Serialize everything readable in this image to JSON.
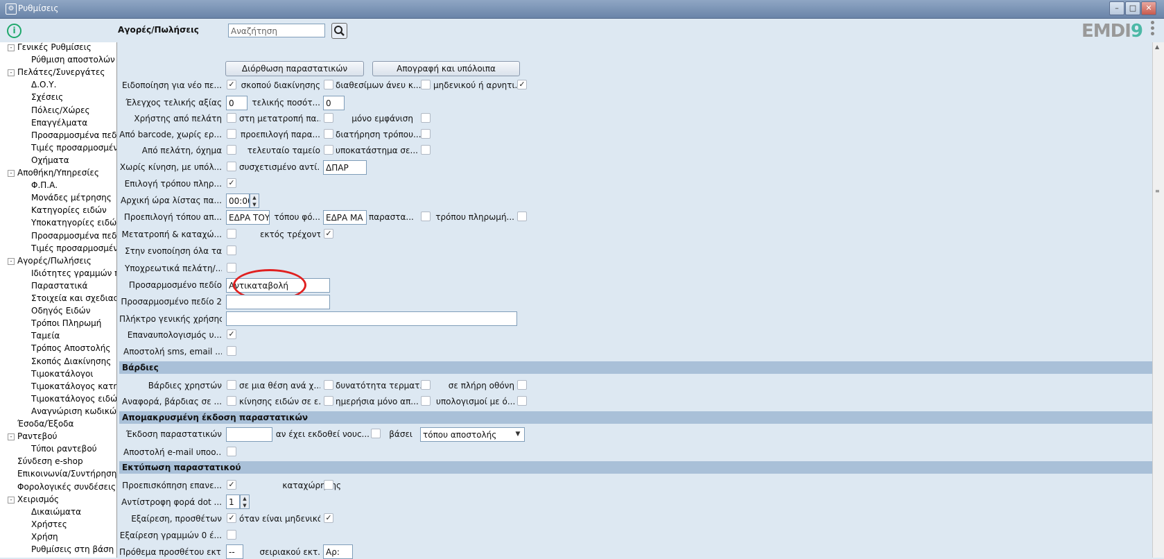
{
  "window": {
    "title": "Ρυθμίσεις"
  },
  "topbar": {
    "title": "Αγορές/Πωλήσεις",
    "search_placeholder": "Αναζήτηση",
    "logo_text": "EMDI",
    "logo_accent": "9"
  },
  "tree": [
    {
      "label": "Γενικές Ρυθμίσεις",
      "level": 0,
      "expander": "-"
    },
    {
      "label": "Ρύθμιση αποστολών",
      "level": 1
    },
    {
      "label": "Πελάτες/Συνεργάτες",
      "level": 0,
      "expander": "-"
    },
    {
      "label": "Δ.Ο.Υ.",
      "level": 1
    },
    {
      "label": "Σχέσεις",
      "level": 1
    },
    {
      "label": "Πόλεις/Χώρες",
      "level": 1
    },
    {
      "label": "Επαγγέλματα",
      "level": 1
    },
    {
      "label": "Προσαρμοσμένα πεδί",
      "level": 1
    },
    {
      "label": "Τιμές προσαρμοσμένω",
      "level": 1
    },
    {
      "label": "Οχήματα",
      "level": 1
    },
    {
      "label": "Αποθήκη/Υπηρεσίες",
      "level": 0,
      "expander": "-"
    },
    {
      "label": "Φ.Π.Α.",
      "level": 1
    },
    {
      "label": "Μονάδες μέτρησης",
      "level": 1
    },
    {
      "label": "Κατηγορίες ειδών",
      "level": 1
    },
    {
      "label": "Υποκατηγορίες ειδών",
      "level": 1
    },
    {
      "label": "Προσαρμοσμένα πεδί",
      "level": 1
    },
    {
      "label": "Τιμές προσαρμοσμένω",
      "level": 1
    },
    {
      "label": "Αγορές/Πωλήσεις",
      "level": 0,
      "expander": "-"
    },
    {
      "label": "Ιδιότητες γραμμών πα",
      "level": 1
    },
    {
      "label": "Παραστατικά",
      "level": 1
    },
    {
      "label": "Στοιχεία και σχεδιασμ",
      "level": 1
    },
    {
      "label": "Οδηγός Ειδών",
      "level": 1
    },
    {
      "label": "Τρόποι Πληρωμή",
      "level": 1
    },
    {
      "label": "Ταμεία",
      "level": 1
    },
    {
      "label": "Τρόπος Αποστολής",
      "level": 1
    },
    {
      "label": "Σκοπός Διακίνησης",
      "level": 1
    },
    {
      "label": "Τιμοκατάλογοι",
      "level": 1
    },
    {
      "label": "Τιμοκατάλογος κατηγ",
      "level": 1
    },
    {
      "label": "Τιμοκατάλογος ειδών",
      "level": 1
    },
    {
      "label": "Αναγνώριση κωδικών",
      "level": 1
    },
    {
      "label": "Έσοδα/Έξοδα",
      "level": 0
    },
    {
      "label": "Ραντεβού",
      "level": 0,
      "expander": "-"
    },
    {
      "label": "Τύποι ραντεβού",
      "level": 1
    },
    {
      "label": "Σύνδεση e-shop",
      "level": 0
    },
    {
      "label": "Επικοινωνία/Συντήρηση",
      "level": 0
    },
    {
      "label": "Φορολογικές συνδέσεις",
      "level": 0
    },
    {
      "label": "Χειρισμός",
      "level": 0,
      "expander": "-"
    },
    {
      "label": "Δικαιώματα",
      "level": 1
    },
    {
      "label": "Χρήστες",
      "level": 1
    },
    {
      "label": "Χρήση",
      "level": 1
    },
    {
      "label": "Ρυθμίσεις στη βάση",
      "level": 1
    }
  ],
  "form": {
    "btn_fix_docs": "Διόρθωση παραστατικών",
    "btn_inventory": "Απογραφή και υπόλοιπα",
    "r1": {
      "l1": "Ειδοποίηση για νέο πε...",
      "l2": "σκοπού διακίνησης",
      "l3": "διαθεσίμων άνευ κ...",
      "l4": "μηδενικού ή αρνητι...",
      "c1": "✓",
      "c2": "",
      "c3": "",
      "c4": "✓"
    },
    "r2": {
      "l1": "Έλεγχος τελικής αξίας",
      "v1": "0",
      "l2": "τελικής ποσότ...",
      "v2": "0"
    },
    "r3": {
      "l1": "Χρήστης από πελάτη",
      "l2": "στη μετατροπή πα...",
      "l3": "μόνο εμφάνιση"
    },
    "r4": {
      "l1": "Από barcode, χωρίς ερ...",
      "l2": "προεπιλογή παρα...",
      "l3": "διατήρηση τρόπου..."
    },
    "r5": {
      "l1": "Από πελάτη, όχημα",
      "l2": "τελευταίο ταμείο",
      "l3": "υποκατάστημα σε..."
    },
    "r6": {
      "l1": "Χωρίς κίνηση, με υπόλ...",
      "l2": "συσχετισμένο αντί...",
      "v1": "ΔΠΑΡ"
    },
    "r7": {
      "l1": "Επιλογή τρόπου πληρ...",
      "c1": "✓"
    },
    "r8": {
      "l1": "Αρχική ώρα λίστας πα...",
      "v1": "00:00"
    },
    "r9": {
      "l1": "Προεπιλογή τόπου απ...",
      "v1": "ΕΔΡΑ ΤΟΥ",
      "l2": "τόπου φό...",
      "v2": "ΕΔΡΑ ΜΑ",
      "l3": "παραστα...",
      "l4": "τρόπου πληρωμή..."
    },
    "r10": {
      "l1": "Μετατροπή & καταχώ...",
      "l2": "εκτός τρέχοντος",
      "c2": "✓"
    },
    "r11": {
      "l1": "Στην ενοποίηση όλα τα..."
    },
    "r12": {
      "l1": "Υποχρεωτικά πελάτη/..."
    },
    "r13": {
      "l1": "Προσαρμοσμένο πεδίο",
      "v1": "Αντικαταβολή"
    },
    "r14": {
      "l1": "Προσαρμοσμένο πεδίο 2",
      "v1": ""
    },
    "r15": {
      "l1": "Πλήκτρο γενικής χρήσης",
      "v1": ""
    },
    "r16": {
      "l1": "Επαναυπολογισμός υ...",
      "c1": "✓"
    },
    "r17": {
      "l1": "Αποστολή sms, email ..."
    },
    "sec_shifts": "Βάρδιες",
    "s1": {
      "l1": "Βάρδιες χρηστών",
      "l2": "σε μια θέση ανά χ...",
      "l3": "δυνατότητα τερματ...",
      "l4": "σε πλήρη οθόνη"
    },
    "s2": {
      "l1": "Αναφορά, βάρδιας σε ...",
      "l2": "κίνησης ειδών σε ε...",
      "l3": "ημερήσια μόνο απ...",
      "l4": "υπολογισμοί με ό..."
    },
    "sec_remote": "Απομακρυσμένη έκδοση παραστατικών",
    "t1": {
      "l1": "Έκδοση παραστατικών",
      "v1": "",
      "l2": "αν έχει εκδοθεί νουc...",
      "l3": "βάσει",
      "v3": "τόπου αποστολής"
    },
    "t2": {
      "l1": "Αποστολή e-mail υποο..."
    },
    "sec_print": "Εκτύπωση παραστατικού",
    "p1": {
      "l1": "Προεπισκόπηση επανε...",
      "c1": "✓",
      "l2": "καταχώρησης"
    },
    "p2": {
      "l1": "Αντίστροφη φορά dot ...",
      "v1": "1"
    },
    "p3": {
      "l1": "Εξαίρεση, προσθέτων",
      "c1": "✓",
      "l2": "όταν είναι μηδενικά",
      "c2": "✓"
    },
    "p4": {
      "l1": "Εξαίρεση γραμμών 0 έ..."
    },
    "p5": {
      "l1": "Πρόθεμα προσθέτου εκτ.",
      "v1": "--",
      "l2": "σειριακού εκτ.",
      "v2": "Αρ:"
    }
  }
}
